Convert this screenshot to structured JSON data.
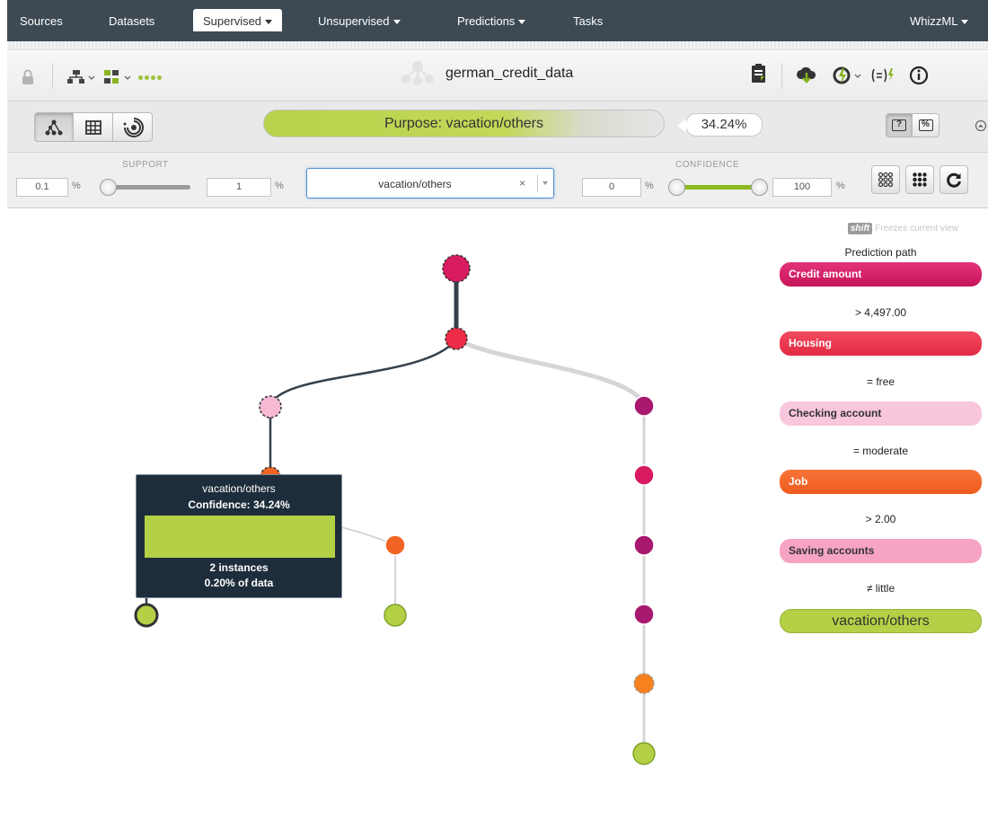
{
  "nav": {
    "items": [
      {
        "label": "Sources",
        "dropdown": false
      },
      {
        "label": "Datasets",
        "dropdown": false
      },
      {
        "label": "Supervised",
        "dropdown": true,
        "active": true
      },
      {
        "label": "Unsupervised",
        "dropdown": true
      },
      {
        "label": "Predictions",
        "dropdown": true
      },
      {
        "label": "Tasks",
        "dropdown": false
      }
    ],
    "right_label": "WhizzML"
  },
  "toolbar": {
    "dataset_title": "german_credit_data",
    "icons": [
      "lock-icon",
      "tree-view-icon",
      "model-icon",
      "progress-dots",
      "dataset-network-icon",
      "download-icon",
      "cloud-download-icon",
      "actions-icon",
      "formula-icon",
      "info-icon"
    ]
  },
  "controls": {
    "purpose_label": "Purpose: vacation/others",
    "purpose_confidence": "34.24%",
    "purpose_fill_fraction": 0.92,
    "view_modes": [
      "tree-view",
      "grid-view",
      "sunburst-view"
    ],
    "active_view": "tree-view",
    "display_toggles": [
      "confidence-key",
      "percent-key"
    ],
    "active_toggle": "confidence-key"
  },
  "filters": {
    "support_label": "SUPPORT",
    "support_min": "0.1",
    "support_max": "1",
    "support_unit": "%",
    "class_filter_value": "vacation/others",
    "class_filter_clear": "×",
    "confidence_label": "CONFIDENCE",
    "confidence_min": "0",
    "confidence_max": "100",
    "confidence_unit": "%"
  },
  "tooltip": {
    "class_name": "vacation/others",
    "confidence_text": "Confidence: 34.24%",
    "instances_text": "2 instances",
    "data_share_text": "0.20% of data"
  },
  "prediction_path": {
    "shift_key": "shift",
    "shift_note": "Freezes current view",
    "title": "Prediction path",
    "steps": [
      {
        "field": "Credit amount",
        "condition": "> 4,497.00",
        "color": "#d81b60"
      },
      {
        "field": "Housing",
        "condition": "= free",
        "color": "#ec2c47"
      },
      {
        "field": "Checking account",
        "condition": "= moderate",
        "color": "#f7b8d4"
      },
      {
        "field": "Job",
        "condition": "> 2.00",
        "color": "#f26424"
      },
      {
        "field": "Saving accounts",
        "condition": "≠ little",
        "color": "#f48fb1"
      }
    ],
    "result": "vacation/others",
    "result_color": "#b4d046"
  },
  "colors": {
    "nav_bg": "#3d4a54",
    "accent_green": "#b4d046",
    "credit_amount": "#d81b60",
    "housing": "#ec2c47",
    "checking_account": "#f7b8d4",
    "job": "#f26424",
    "saving_accounts": "#f48fb1",
    "purpose_node": "#a8186e",
    "leaf": "#b4d046"
  }
}
